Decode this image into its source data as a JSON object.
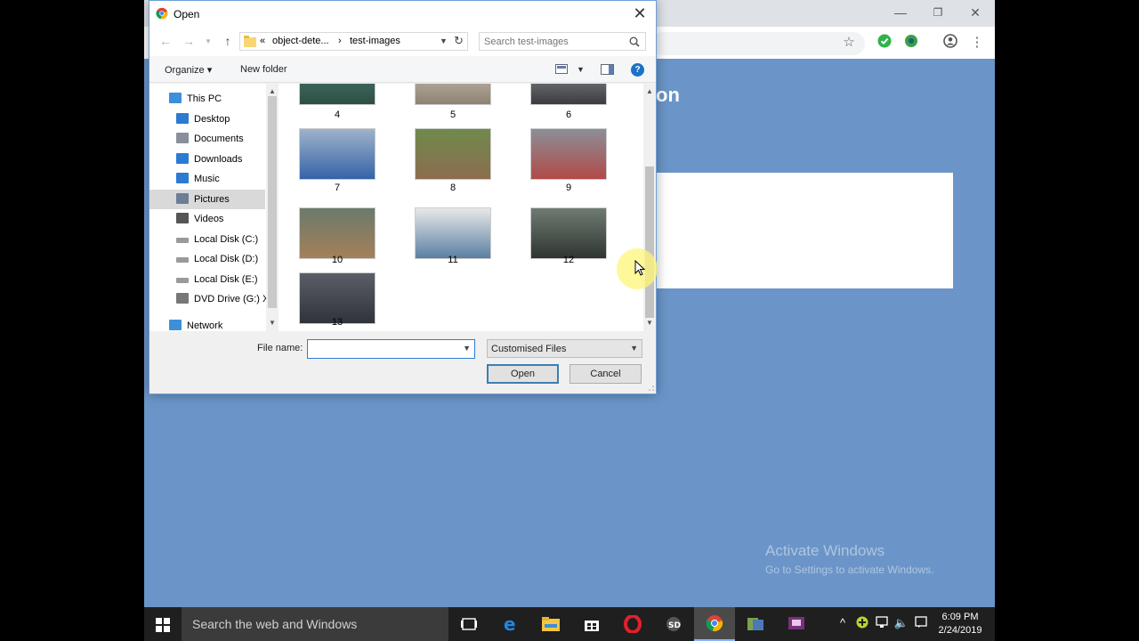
{
  "dialog": {
    "title": "Open",
    "breadcrumb": [
      "«",
      "object-dete...",
      "›",
      "test-images"
    ],
    "search_placeholder": "Search test-images",
    "organize_label": "Organize ▾",
    "new_folder_label": "New folder",
    "help_label": "?",
    "close_label": "✕",
    "nav_items": [
      {
        "label": "This PC",
        "icon": "pc-icon",
        "indent": 0
      },
      {
        "label": "Desktop",
        "icon": "desktop-icon",
        "indent": 1
      },
      {
        "label": "Documents",
        "icon": "documents-icon",
        "indent": 1
      },
      {
        "label": "Downloads",
        "icon": "downloads-icon",
        "indent": 1
      },
      {
        "label": "Music",
        "icon": "music-icon",
        "indent": 1
      },
      {
        "label": "Pictures",
        "icon": "pictures-icon",
        "indent": 1,
        "selected": true
      },
      {
        "label": "Videos",
        "icon": "videos-icon",
        "indent": 1
      },
      {
        "label": "Local Disk (C:)",
        "icon": "disk-icon",
        "indent": 1
      },
      {
        "label": "Local Disk (D:)",
        "icon": "disk-icon",
        "indent": 1
      },
      {
        "label": "Local Disk (E:)",
        "icon": "disk-icon",
        "indent": 1
      },
      {
        "label": "DVD Drive (G:) X",
        "icon": "dvd-icon",
        "indent": 1
      },
      {
        "label": "Network",
        "icon": "network-icon",
        "indent": 0
      }
    ],
    "files": [
      {
        "name": "4",
        "color1": "#4f7f7a",
        "color2": "#2e4f44"
      },
      {
        "name": "5",
        "color1": "#d7d0c6",
        "color2": "#8e8272"
      },
      {
        "name": "6",
        "color1": "#9b9ea3",
        "color2": "#3b3c40"
      },
      {
        "name": "7",
        "color1": "#9fb3c9",
        "color2": "#3563a8"
      },
      {
        "name": "8",
        "color1": "#6f8a4d",
        "color2": "#8c6d4e"
      },
      {
        "name": "9",
        "color1": "#8b8f98",
        "color2": "#b14a48"
      },
      {
        "name": "10",
        "color1": "#6b7a6a",
        "color2": "#a4805a"
      },
      {
        "name": "11",
        "color1": "#e8e8e8",
        "color2": "#5b7fa3"
      },
      {
        "name": "12",
        "color1": "#6f7b72",
        "color2": "#2f3531"
      },
      {
        "name": "13",
        "color1": "#5a5e66",
        "color2": "#30343a"
      }
    ],
    "filename_label": "File name:",
    "filename_value": "",
    "filetype_value": "Customised Files",
    "open_label": "Open",
    "cancel_label": "Cancel"
  },
  "page": {
    "title_fragment": "on"
  },
  "watermark": {
    "line1": "Activate Windows",
    "line2": "Go to Settings to activate Windows."
  },
  "taskbar": {
    "search_text": "Search the web and Windows",
    "time": "6:09 PM",
    "date": "2/24/2019"
  }
}
